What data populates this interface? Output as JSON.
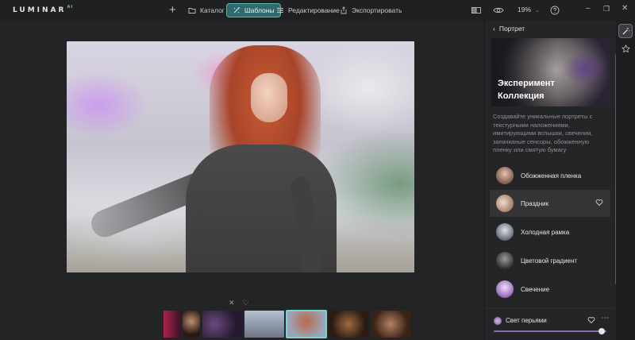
{
  "app": {
    "logo": "LUMINAR",
    "logo_suffix": "AI"
  },
  "nav": {
    "catalog": "Каталог",
    "templates": "Шаблоны",
    "edit": "Редактирование",
    "export": "Экспортировать"
  },
  "toolbar": {
    "zoom": "19%"
  },
  "panel": {
    "back_label": "Портрет",
    "hero_title": "Эксперимент",
    "hero_subtitle": "Коллекция",
    "description": "Создавайте уникальные портреты с текстурными наложениями, имитирующими вспышки, свечения, запачканые сенсоры, обожженную пленку или смятую бумагу",
    "presets": [
      {
        "label": "Обожженная пленка",
        "color": "#b58a7a"
      },
      {
        "label": "Праздник",
        "color": "#c9a58c",
        "active": true
      },
      {
        "label": "Холодная рамка",
        "color": "#8e96a2"
      },
      {
        "label": "Цветовой градиент",
        "color": "#4a4b4d"
      },
      {
        "label": "Свечение",
        "color": "#b488d4"
      }
    ],
    "applied": {
      "label": "Свет перьями",
      "amount": 0.96
    }
  },
  "colors": {
    "accent": "#2f6b6c",
    "accent_border": "#5fb3ae",
    "slider": "#8b6db0"
  }
}
